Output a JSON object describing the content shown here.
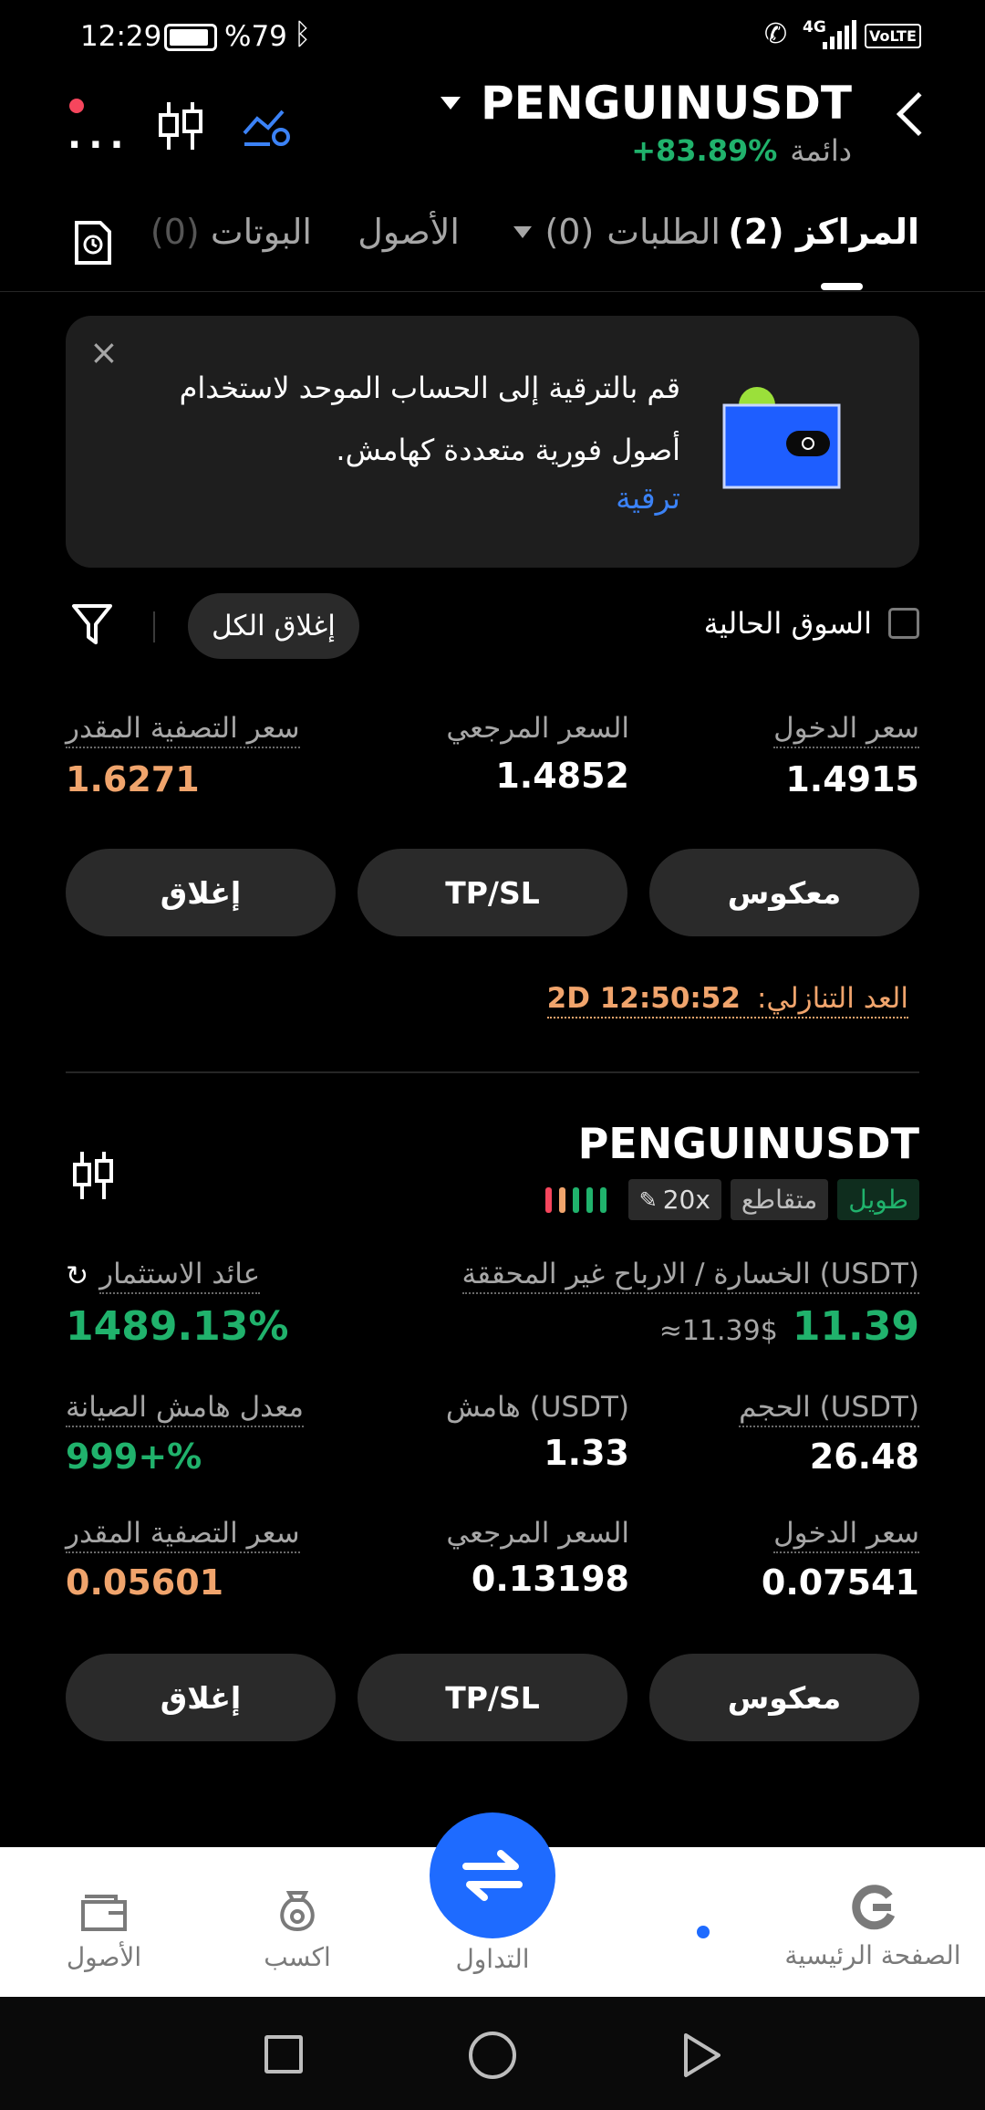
{
  "status_bar": {
    "time": "12:29",
    "battery": "%79",
    "network": "4G",
    "volte": "VoLTE"
  },
  "header": {
    "symbol": "PENGUINUSDT",
    "type": "دائمة",
    "change": "+83.89%"
  },
  "tabs": [
    {
      "label": "المراكز",
      "count": "(2)"
    },
    {
      "label": "الطلبات",
      "count": "(0)"
    },
    {
      "label": "الأصول",
      "count": ""
    },
    {
      "label": "البوتات",
      "count": "(0)"
    }
  ],
  "banner": {
    "line1": "قم بالترقية إلى الحساب الموحد لاستخدام",
    "line2": "أصول فورية متعددة كهامش.",
    "link": "ترقية"
  },
  "filters": {
    "current_market": "السوق الحالية",
    "close_all": "إغلاق الكل"
  },
  "position1": {
    "entry_label": "سعر الدخول",
    "entry_value": "1.4915",
    "mark_label": "السعر المرجعي",
    "mark_value": "1.4852",
    "liq_label": "سعر التصفية المقدر",
    "liq_value": "1.6271",
    "reverse_btn": "معكوس",
    "tpsl_btn": "TP/SL",
    "close_btn": "إغلاق",
    "countdown_label": "العد التنازلي:",
    "countdown_value": "2D 12:50:52"
  },
  "position2": {
    "symbol": "PENGUINUSDT",
    "tag_long": "طويل",
    "tag_cross": "متقاطع",
    "tag_leverage": "20x",
    "pnl_label": "الخسارة / الارباح غير المحققة (USDT)",
    "pnl_value": "11.39",
    "pnl_approx": "≈11.39$",
    "roi_label": "عائد الاستثمار",
    "roi_value": "1489.13%",
    "size_label": "الحجم (USDT)",
    "size_value": "26.48",
    "margin_label": "هامش (USDT)",
    "margin_value": "1.33",
    "mmr_label": "معدل هامش الصيانة",
    "mmr_value": "999+%",
    "entry_label": "سعر الدخول",
    "entry_value": "0.07541",
    "mark_label": "السعر المرجعي",
    "mark_value": "0.13198",
    "liq_label": "سعر التصفية المقدر",
    "liq_value": "0.05601",
    "reverse_btn": "معكوس",
    "tpsl_btn": "TP/SL",
    "close_btn": "إغلاق"
  },
  "bottom_nav": [
    {
      "label": "الصفحة الرئيسية",
      "icon": "home-logo-icon"
    },
    {
      "label": "",
      "icon": "dot-icon"
    },
    {
      "label": "التداول",
      "icon": "swap-icon"
    },
    {
      "label": "اكسب",
      "icon": "earn-bag-icon"
    },
    {
      "label": "الأصول",
      "icon": "wallet-icon"
    }
  ],
  "colors": {
    "green": "#20b26c",
    "orange": "#f0a46c",
    "blue": "#1e6bff",
    "bg": "#000000"
  }
}
